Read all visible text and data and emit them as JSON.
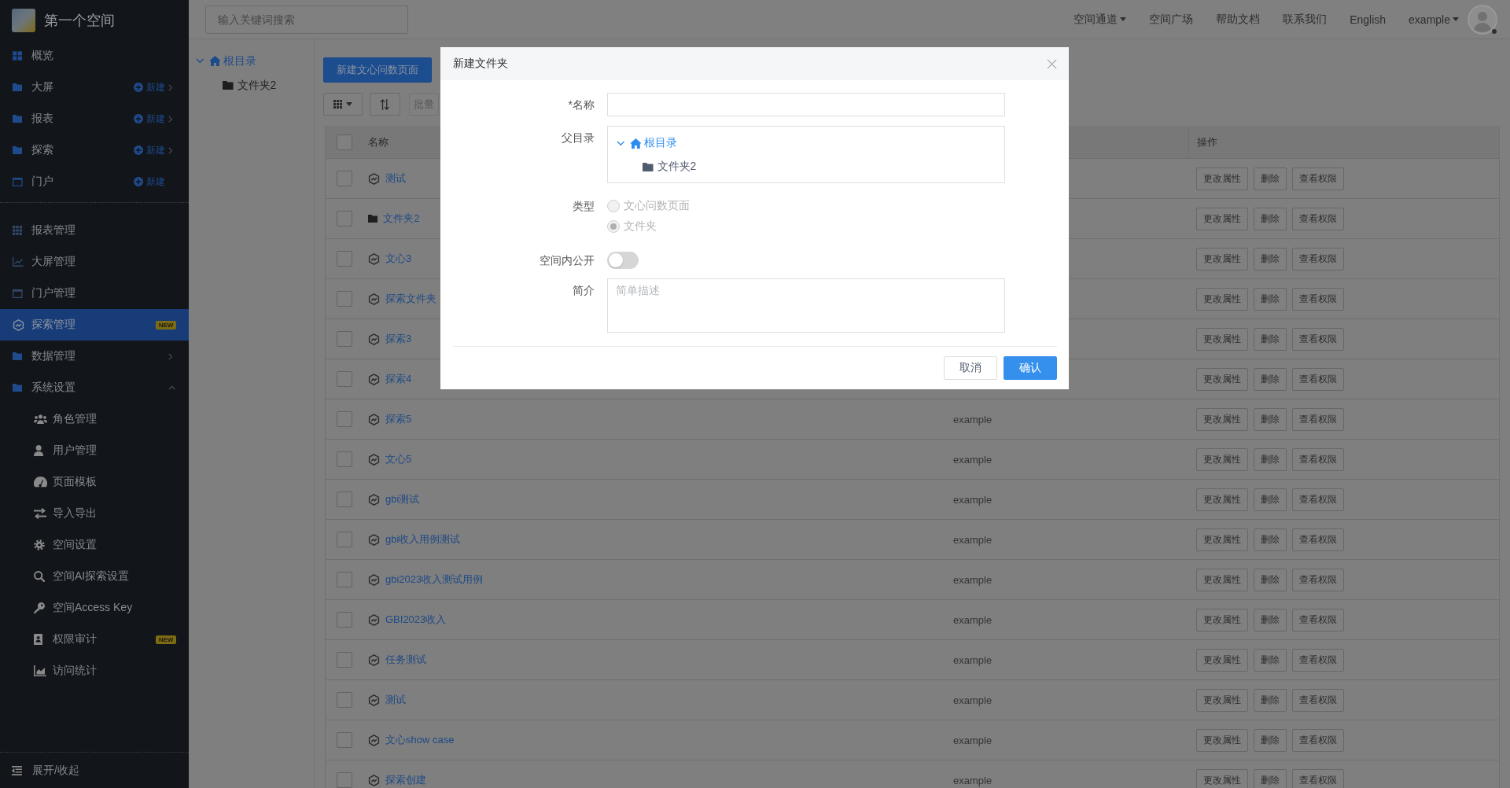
{
  "sidebar": {
    "space_name": "第一个空间",
    "sections": [
      {
        "items": [
          {
            "label": "概览",
            "kind": "link",
            "selected": false
          },
          {
            "label": "大屏",
            "kind": "submenu",
            "expanded": false,
            "action": "新建",
            "selected": false
          },
          {
            "label": "报表",
            "kind": "submenu",
            "expanded": false,
            "action": "新建",
            "selected": false
          },
          {
            "label": "探索",
            "kind": "submenu",
            "expanded": false,
            "action": "新建",
            "selected": false
          },
          {
            "label": "门户",
            "kind": "link",
            "action": "新建",
            "selected": false
          }
        ]
      },
      {
        "items": [
          {
            "label": "报表管理",
            "kind": "link",
            "selected": false
          },
          {
            "label": "大屏管理",
            "kind": "link",
            "selected": false
          },
          {
            "label": "门户管理",
            "kind": "link",
            "selected": false
          },
          {
            "label": "探索管理",
            "kind": "link",
            "badge": "NEW",
            "selected": true
          },
          {
            "label": "数据管理",
            "kind": "submenu",
            "expanded": false,
            "selected": false
          },
          {
            "label": "系统设置",
            "kind": "submenu",
            "expanded": true,
            "selected": false,
            "children": [
              {
                "label": "角色管理",
                "selected": false
              },
              {
                "label": "用户管理",
                "selected": false
              },
              {
                "label": "页面模板",
                "selected": false
              },
              {
                "label": "导入导出",
                "selected": false
              },
              {
                "label": "空间设置",
                "selected": false
              },
              {
                "label": "空间AI探索设置",
                "selected": false
              },
              {
                "label": "空间Access Key",
                "selected": false
              },
              {
                "label": "权限审计",
                "badge": "NEW",
                "selected": false
              },
              {
                "label": "访问统计",
                "selected": false
              }
            ]
          }
        ]
      }
    ],
    "collapse_label": "展开/收起"
  },
  "top_bar": {
    "search": {
      "placeholder": "输入关键词搜索"
    },
    "links": [
      {
        "label": "空间通道",
        "kind": "dropdown"
      },
      {
        "label": "空间广场",
        "kind": "link"
      },
      {
        "label": "帮助文档",
        "kind": "link"
      },
      {
        "label": "联系我们",
        "kind": "link"
      },
      {
        "label": "English",
        "kind": "link"
      },
      {
        "label": "example",
        "kind": "dropdown"
      }
    ]
  },
  "folder_tree": {
    "label": "根目录",
    "expanded": true,
    "selected": true,
    "children": [
      {
        "label": "文件夹2",
        "selected": false
      }
    ]
  },
  "toolbar": {
    "new_button": "新建文心问数页面",
    "batch_button": {
      "label": "批量",
      "disabled": true
    }
  },
  "table": {
    "header": {
      "checked": false,
      "name_column": "名称",
      "actions_column": "操作"
    },
    "rows": [
      {
        "kind": "page",
        "name": "测试",
        "checked": false,
        "actions": [
          "更改属性",
          "删除",
          "查看权限"
        ]
      },
      {
        "kind": "folder",
        "name": "文件夹2",
        "checked": false,
        "actions": [
          "更改属性",
          "删除",
          "查看权限"
        ]
      },
      {
        "kind": "page",
        "name": "文心3",
        "checked": false,
        "actions": [
          "更改属性",
          "删除",
          "查看权限"
        ]
      },
      {
        "kind": "page",
        "name": "探索文件夹",
        "checked": false,
        "actions": [
          "更改属性",
          "删除",
          "查看权限"
        ]
      },
      {
        "kind": "page",
        "name": "探索3",
        "checked": false,
        "actions": [
          "更改属性",
          "删除",
          "查看权限"
        ]
      },
      {
        "kind": "page",
        "name": "探索4",
        "checked": false,
        "actions": [
          "更改属性",
          "删除",
          "查看权限"
        ]
      },
      {
        "kind": "page",
        "name": "探索5",
        "owner": "example",
        "checked": false,
        "actions": [
          "更改属性",
          "删除",
          "查看权限"
        ]
      },
      {
        "kind": "page",
        "name": "文心5",
        "owner": "example",
        "checked": false,
        "actions": [
          "更改属性",
          "删除",
          "查看权限"
        ]
      },
      {
        "kind": "page",
        "name": "gbi测试",
        "owner": "example",
        "checked": false,
        "actions": [
          "更改属性",
          "删除",
          "查看权限"
        ]
      },
      {
        "kind": "page",
        "name": "gbi收入用例测试",
        "owner": "example",
        "checked": false,
        "actions": [
          "更改属性",
          "删除",
          "查看权限"
        ]
      },
      {
        "kind": "page",
        "name": "gbi2023收入测试用例",
        "owner": "example",
        "checked": false,
        "actions": [
          "更改属性",
          "删除",
          "查看权限"
        ]
      },
      {
        "kind": "page",
        "name": "GBI2023收入",
        "owner": "example",
        "checked": false,
        "actions": [
          "更改属性",
          "删除",
          "查看权限"
        ]
      },
      {
        "kind": "page",
        "name": "任务测试",
        "owner": "example",
        "checked": false,
        "actions": [
          "更改属性",
          "删除",
          "查看权限"
        ]
      },
      {
        "kind": "page",
        "name": "测试",
        "owner": "example",
        "checked": false,
        "actions": [
          "更改属性",
          "删除",
          "查看权限"
        ]
      },
      {
        "kind": "page",
        "name": "文心show case",
        "owner": "example",
        "checked": false,
        "actions": [
          "更改属性",
          "删除",
          "查看权限"
        ]
      },
      {
        "kind": "page",
        "name": "探索创建",
        "owner": "example",
        "checked": false,
        "actions": [
          "更改属性",
          "删除",
          "查看权限"
        ]
      }
    ]
  },
  "dialog": {
    "title": "新建文件夹",
    "fields": [
      {
        "kind": "text",
        "label": "*名称"
      },
      {
        "kind": "tree",
        "label": "父目录",
        "tree": {
          "label": "根目录",
          "expanded": true,
          "selected": true,
          "children": [
            {
              "label": "文件夹2",
              "selected": false
            }
          ]
        }
      },
      {
        "kind": "radio",
        "label": "类型",
        "disabled": true,
        "options": [
          {
            "label": "文心问数页面",
            "selected": false
          },
          {
            "label": "文件夹",
            "selected": true
          }
        ]
      },
      {
        "kind": "switch",
        "label": "空间内公开",
        "on": false
      },
      {
        "kind": "textarea",
        "label": "简介",
        "placeholder": "简单描述"
      }
    ],
    "buttons": [
      {
        "label": "取消",
        "kind": "secondary"
      },
      {
        "label": "确认",
        "kind": "primary"
      }
    ]
  }
}
